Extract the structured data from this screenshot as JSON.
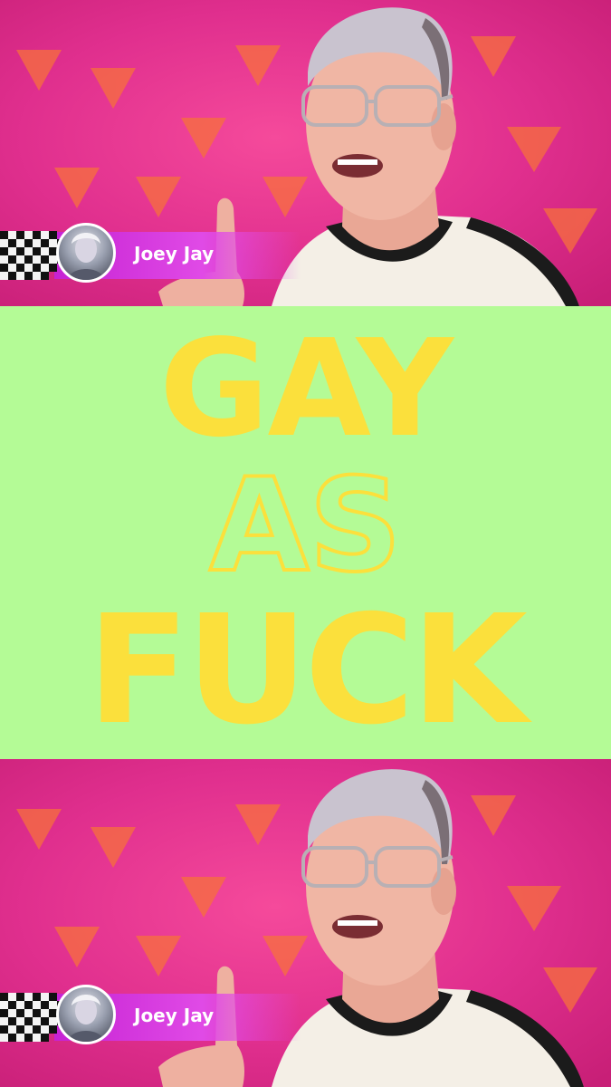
{
  "clips": [
    {
      "name_label": "Joey Jay"
    },
    {
      "name_label": "Joey Jay"
    }
  ],
  "caption": {
    "line_1": "GAY",
    "line_2": "AS",
    "line_3": "FUCK"
  },
  "colors": {
    "band_background": "#b4fb96",
    "caption_yellow": "#fbe03c",
    "backdrop_pink": "#e8349a",
    "lower_third_magenta": "#c622d3"
  }
}
